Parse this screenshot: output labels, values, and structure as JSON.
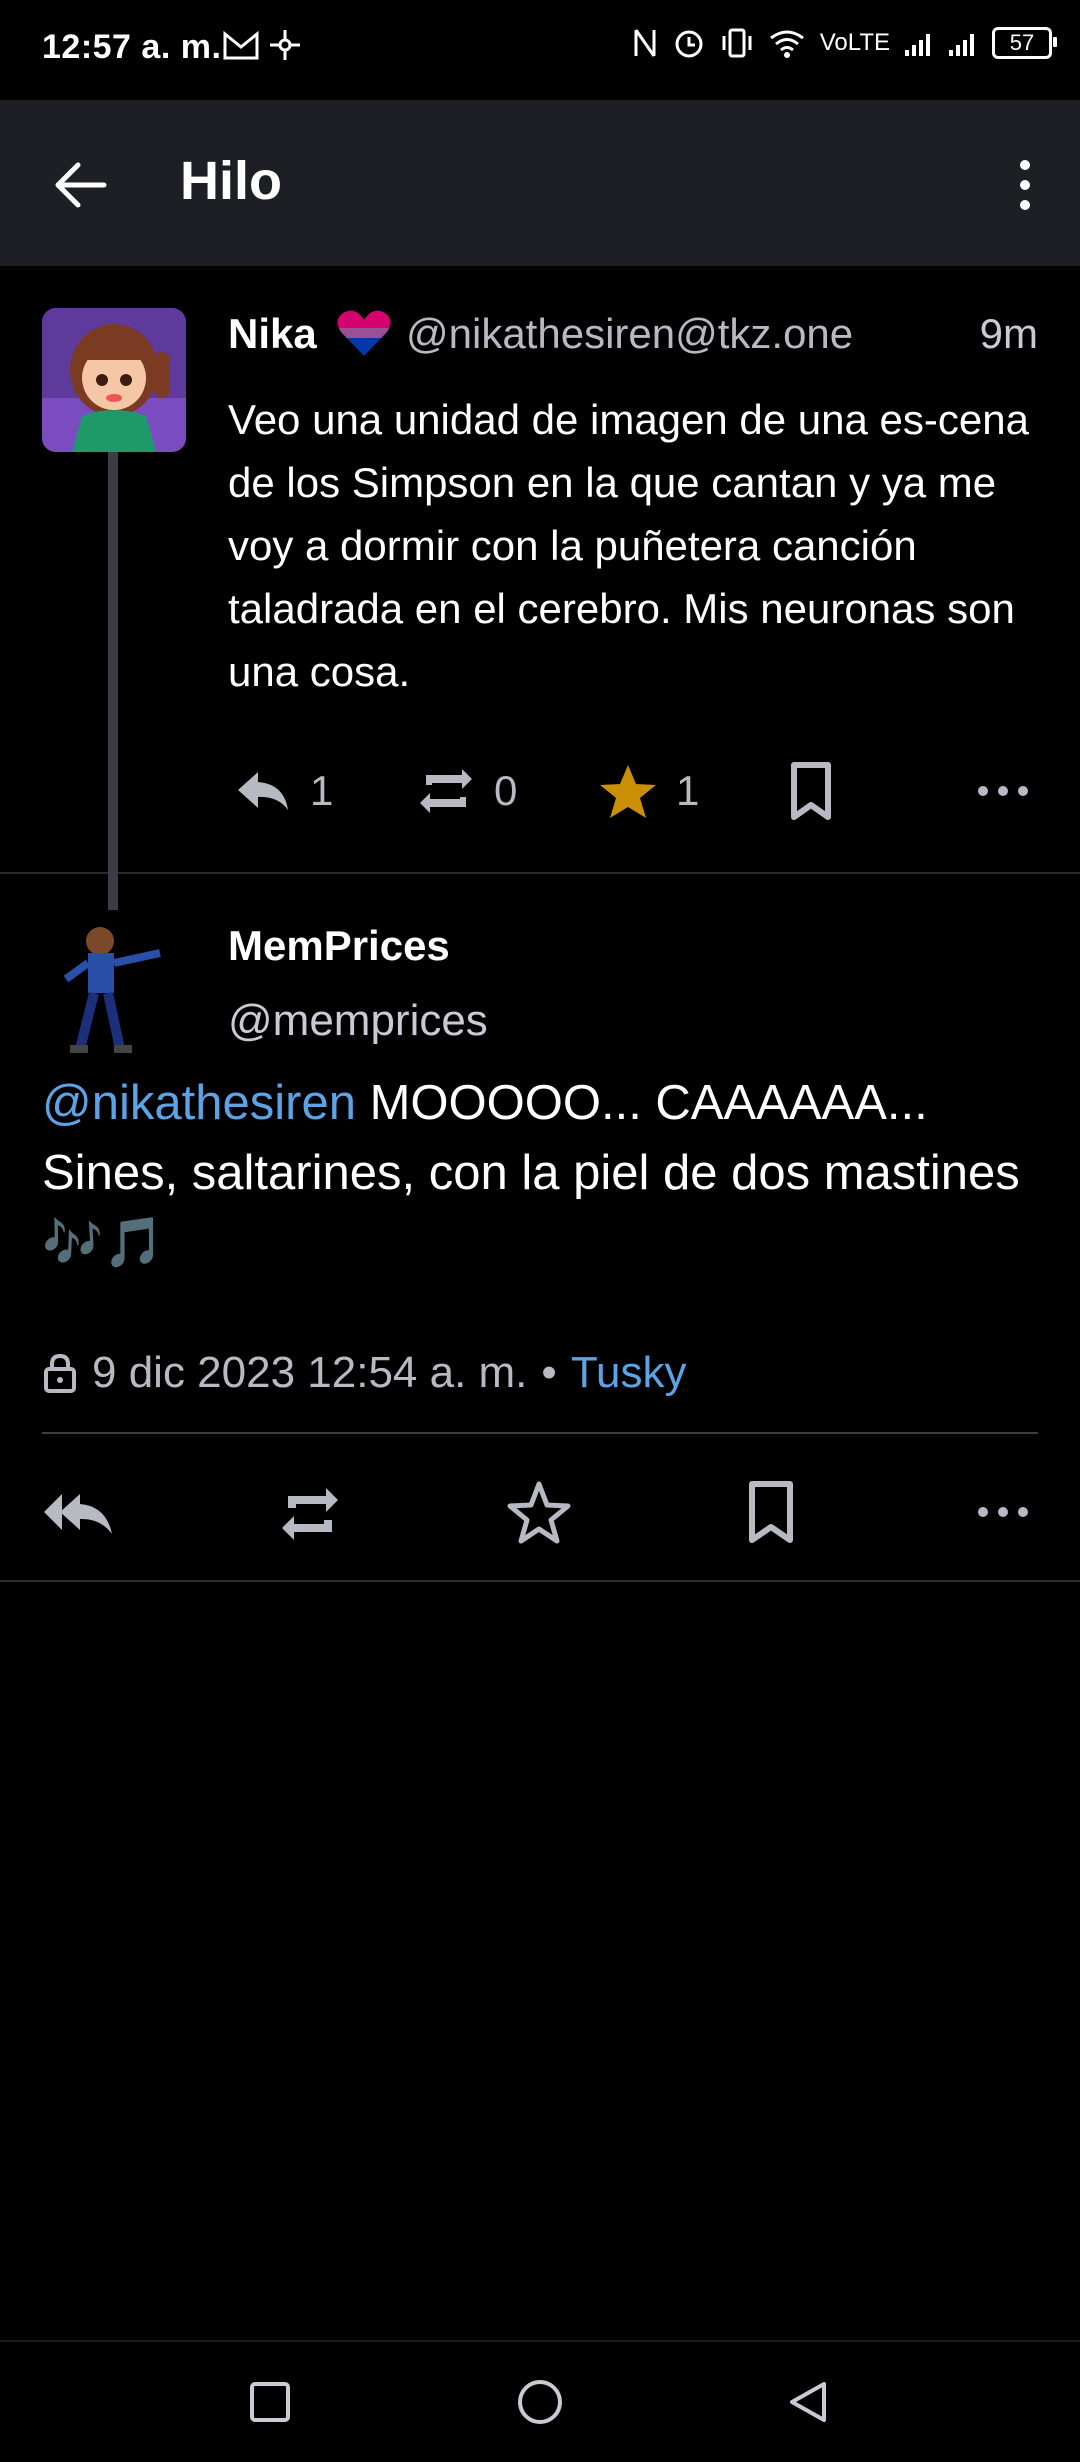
{
  "status_bar": {
    "time": "12:57 a. m.",
    "network": "VoLTE",
    "battery": "57"
  },
  "app_bar": {
    "title": "Hilo"
  },
  "post_parent": {
    "display_name": "Nika",
    "handle": "@nikathesiren@tkz.one",
    "relative_time": "9m",
    "content": "Veo una unidad de imagen de una es-cena de los Simpson en la que cantan y ya me voy a dormir con la puñetera canción taladrada en el cerebro. Mis neuronas son una cosa.",
    "replies": "1",
    "boosts": "0",
    "favourites": "1"
  },
  "post_detail": {
    "display_name": "MemPrices",
    "handle": "@memprices",
    "mention": "@nikathesiren",
    "content": " MOOOOO... CAAAAAA... Sines, saltarines, con la piel de dos mastines 🎶🎵",
    "date": "9 dic 2023 12:54 a. m.",
    "separator": "•",
    "app": "Tusky"
  },
  "colors": {
    "background": "#000000",
    "appbar": "#1e1f25",
    "link": "#5ca3e6",
    "star": "#ca8f04",
    "muted": "#b7b9c3"
  }
}
